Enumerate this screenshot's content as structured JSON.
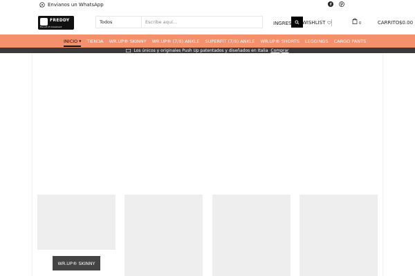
{
  "topbar": {
    "whatsapp_label": "Envianos un WhatsApp",
    "social": [
      "facebook-icon",
      "pinterest-icon"
    ]
  },
  "header": {
    "logo_text": "FREDDY",
    "logo_tagline": "the art of movement",
    "search": {
      "category": "Todos",
      "placeholder": "Escribe aquí..."
    },
    "login_label": "INGRESA",
    "wishlist_label": "WISHLIST",
    "cart_count": "0",
    "cart_label": "CARRITO",
    "cart_total": "$0.00"
  },
  "nav": {
    "items": [
      {
        "label": "INICIO"
      },
      {
        "label": "TIENDA"
      },
      {
        "label": "WR.UP® SKINNY"
      },
      {
        "label": "WR.UP® (7/8) ANKLE"
      },
      {
        "label": "SUPERFIT (7/8) ANKLE"
      },
      {
        "label": "WR.UP® SHORTS"
      },
      {
        "label": "LEGGINGS"
      },
      {
        "label": "CARGO PANTS"
      }
    ]
  },
  "promo": {
    "text": "Los únicos y originales Push Up patentados y diseñados en Italia",
    "link": "Comprar"
  },
  "categories": [
    {
      "label": "WR.UP® SKINNY"
    }
  ],
  "colors": {
    "nav_bg": "#f5906c",
    "promo_bg": "#3a3a3a",
    "card_bg": "#eeeeee",
    "button_bg": "#444444"
  }
}
